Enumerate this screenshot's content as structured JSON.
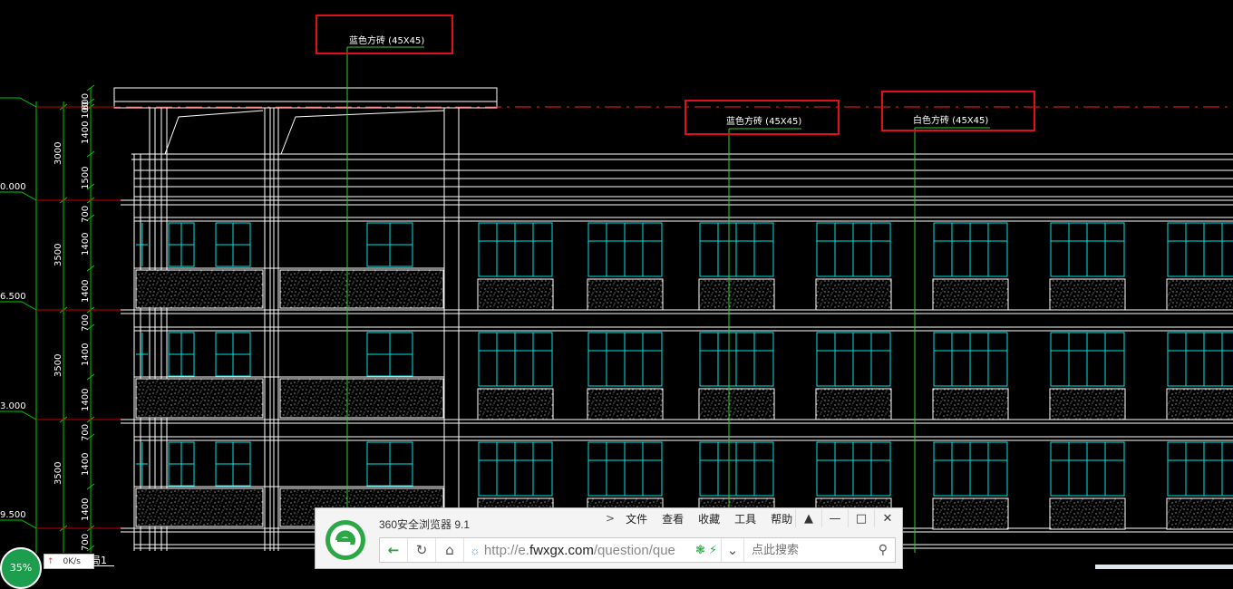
{
  "drawing": {
    "annotations": [
      {
        "id": "note-top",
        "text": "蓝色方砖 (45X45)"
      },
      {
        "id": "note-mid",
        "text": "蓝色方砖 (45X45)"
      },
      {
        "id": "note-right",
        "text": "白色方砖 (45X45)"
      }
    ],
    "elevation_labels": [
      "0.000",
      "6.500",
      "3.000",
      "9.500"
    ],
    "dims_inner": [
      "600",
      "100",
      "1400",
      "1500",
      "700",
      "1400",
      "1400",
      "700",
      "1400",
      "1400",
      "700",
      "1400",
      "1400",
      "700"
    ],
    "dims_outer": [
      "3000",
      "3500",
      "3500",
      "3500"
    ],
    "colors": {
      "background": "#000000",
      "line": "#ffffff",
      "window": "#00e5e5",
      "leader": "#33cc33",
      "dimension": "#00cc00",
      "highlight_box": "#e0101a",
      "axis": "#ff2020"
    }
  },
  "browser": {
    "title": "360安全浏览器 9.1",
    "menu": [
      "文件",
      "查看",
      "收藏",
      "工具",
      "帮助"
    ],
    "menu_chevron": ">",
    "window_controls": [
      "shirt-icon",
      "minimize-icon",
      "maximize-icon",
      "close-icon"
    ],
    "url_prefix": "http://e.",
    "url_domain": "fwxgx.com",
    "url_path": "/question/que",
    "search_placeholder": "点此搜索"
  },
  "status": {
    "zoom": "35%",
    "speed": "0K/s",
    "layout_tab": "局1"
  }
}
